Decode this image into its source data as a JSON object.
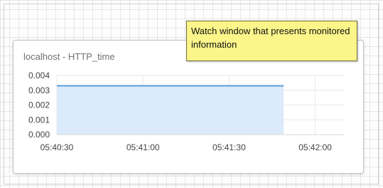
{
  "watch": {
    "title": "localhost - HTTP_time"
  },
  "tooltip": {
    "text": "Watch window that presents monitored information"
  },
  "colors": {
    "line": "#5b9bd5",
    "fill": "#dcebfb",
    "tooltip_bg": "#fbf58a"
  },
  "chart_data": {
    "type": "area",
    "title": "localhost - HTTP_time",
    "xlabel": "",
    "ylabel": "",
    "x_ticks": [
      "05:40:30",
      "05:41:00",
      "05:41:30",
      "05:42:00"
    ],
    "x_tick_seconds": [
      0,
      30,
      60,
      90
    ],
    "xlim": [
      0,
      100
    ],
    "y_ticks": [
      "0.004",
      "0.003",
      "0.002",
      "0.001",
      "0.000"
    ],
    "ylim": [
      0,
      0.004
    ],
    "grid": true,
    "series": [
      {
        "x": [
          0,
          79
        ],
        "values": [
          0.0033,
          0.0033
        ]
      }
    ]
  }
}
